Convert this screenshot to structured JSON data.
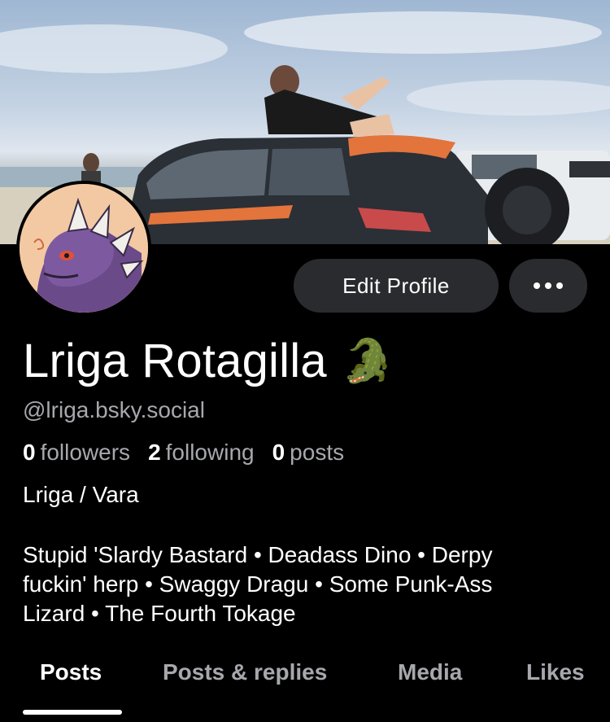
{
  "banner": {
    "description_icon": "banner-photo"
  },
  "avatar": {
    "icon": "dinosaur-avatar"
  },
  "actions": {
    "edit_label": "Edit Profile",
    "more_icon": "more-dots-icon"
  },
  "profile": {
    "display_name": "Lriga Rotagilla",
    "name_emoji": "🐊",
    "handle": "@lriga.bsky.social",
    "stats": {
      "followers_count": "0",
      "followers_label": "followers",
      "following_count": "2",
      "following_label": "following",
      "posts_count": "0",
      "posts_label": "posts"
    },
    "bio_title": "Lriga / Vara",
    "bio_lines": [
      "Stupid 'Slardy Bastard • Deadass Dino • Derpy",
      "fuckin' herp • Swaggy Dragu • Some Punk-Ass",
      "Lizard • The Fourth Tokage"
    ]
  },
  "tabs": [
    {
      "label": "Posts",
      "active": true
    },
    {
      "label": "Posts & replies",
      "active": false
    },
    {
      "label": "Media",
      "active": false
    },
    {
      "label": "Likes",
      "active": false
    }
  ]
}
